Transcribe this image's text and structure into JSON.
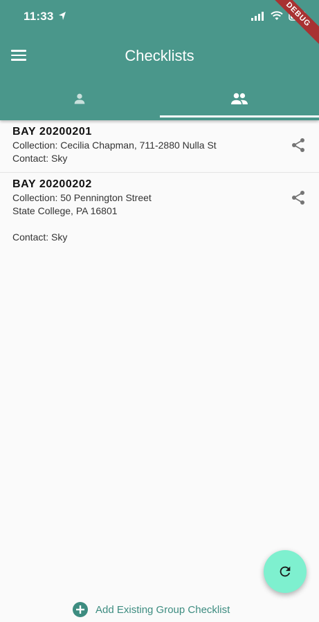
{
  "status_bar": {
    "time": "11:33",
    "debug_label": "DEBUG"
  },
  "header": {
    "title": "Checklists"
  },
  "tabs": [
    {
      "icon": "person-icon",
      "active": false
    },
    {
      "icon": "group-icon",
      "active": true
    }
  ],
  "checklists": [
    {
      "title": "BAY 20200201",
      "collection": "Collection: Cecilia Chapman, 711-2880 Nulla St",
      "contact": "Contact: Sky"
    },
    {
      "title": "BAY 20200202",
      "collection": "Collection: 50 Pennington Street",
      "collection_line2": "State College, PA 16801",
      "contact": "Contact: Sky"
    }
  ],
  "actions": {
    "add_existing_label": "Add Existing Group Checklist"
  },
  "colors": {
    "primary": "#4a978b",
    "fab": "#7ef0cf",
    "accent_text": "#3d8c80"
  }
}
